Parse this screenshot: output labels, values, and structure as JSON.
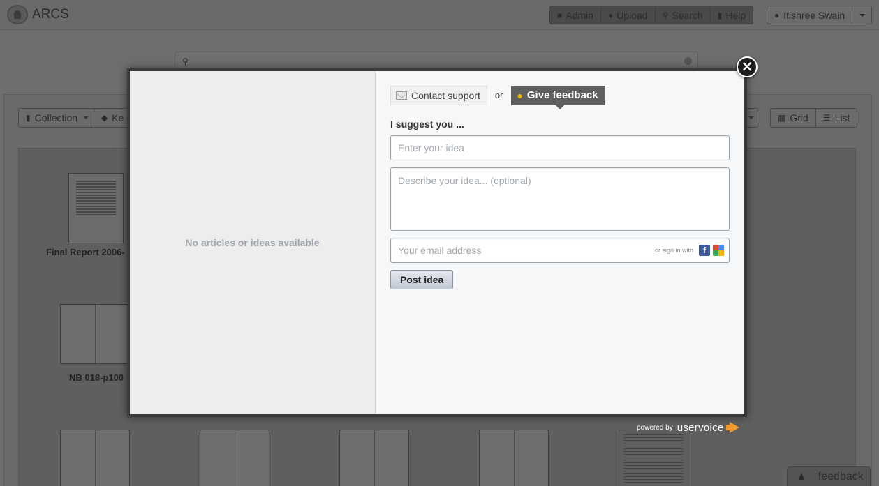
{
  "app": {
    "brand": "ARCS"
  },
  "nav": {
    "admin": "Admin",
    "upload": "Upload",
    "search": "Search",
    "help": "Help",
    "user": "Itishree Swain"
  },
  "toolbar": {
    "collection": "Collection",
    "keyword_partial": "Ke",
    "grid": "Grid",
    "list": "List"
  },
  "thumbnails": {
    "first_label": "Final Report 2006-",
    "second_label": "NB 018-p100"
  },
  "modal": {
    "empty_text": "No articles or ideas available",
    "tab_contact": "Contact support",
    "tab_or": "or",
    "tab_feedback": "Give feedback",
    "suggest_label": "I suggest you ...",
    "idea_placeholder": "Enter your idea",
    "description_placeholder": "Describe your idea... (optional)",
    "email_placeholder": "Your email address",
    "signin_text": "or sign in with",
    "facebook_letter": "f",
    "post_button": "Post idea",
    "close_symbol": "×"
  },
  "footer": {
    "powered_by": "powered by",
    "uservoice": "uservoice",
    "feedback_tab": "feedback"
  },
  "colors": {
    "feedback_tab_active": "#5f5f5f",
    "bulb": "#f0b400",
    "facebook": "#3b5998",
    "uservoice_orange": "#f29a2e"
  }
}
